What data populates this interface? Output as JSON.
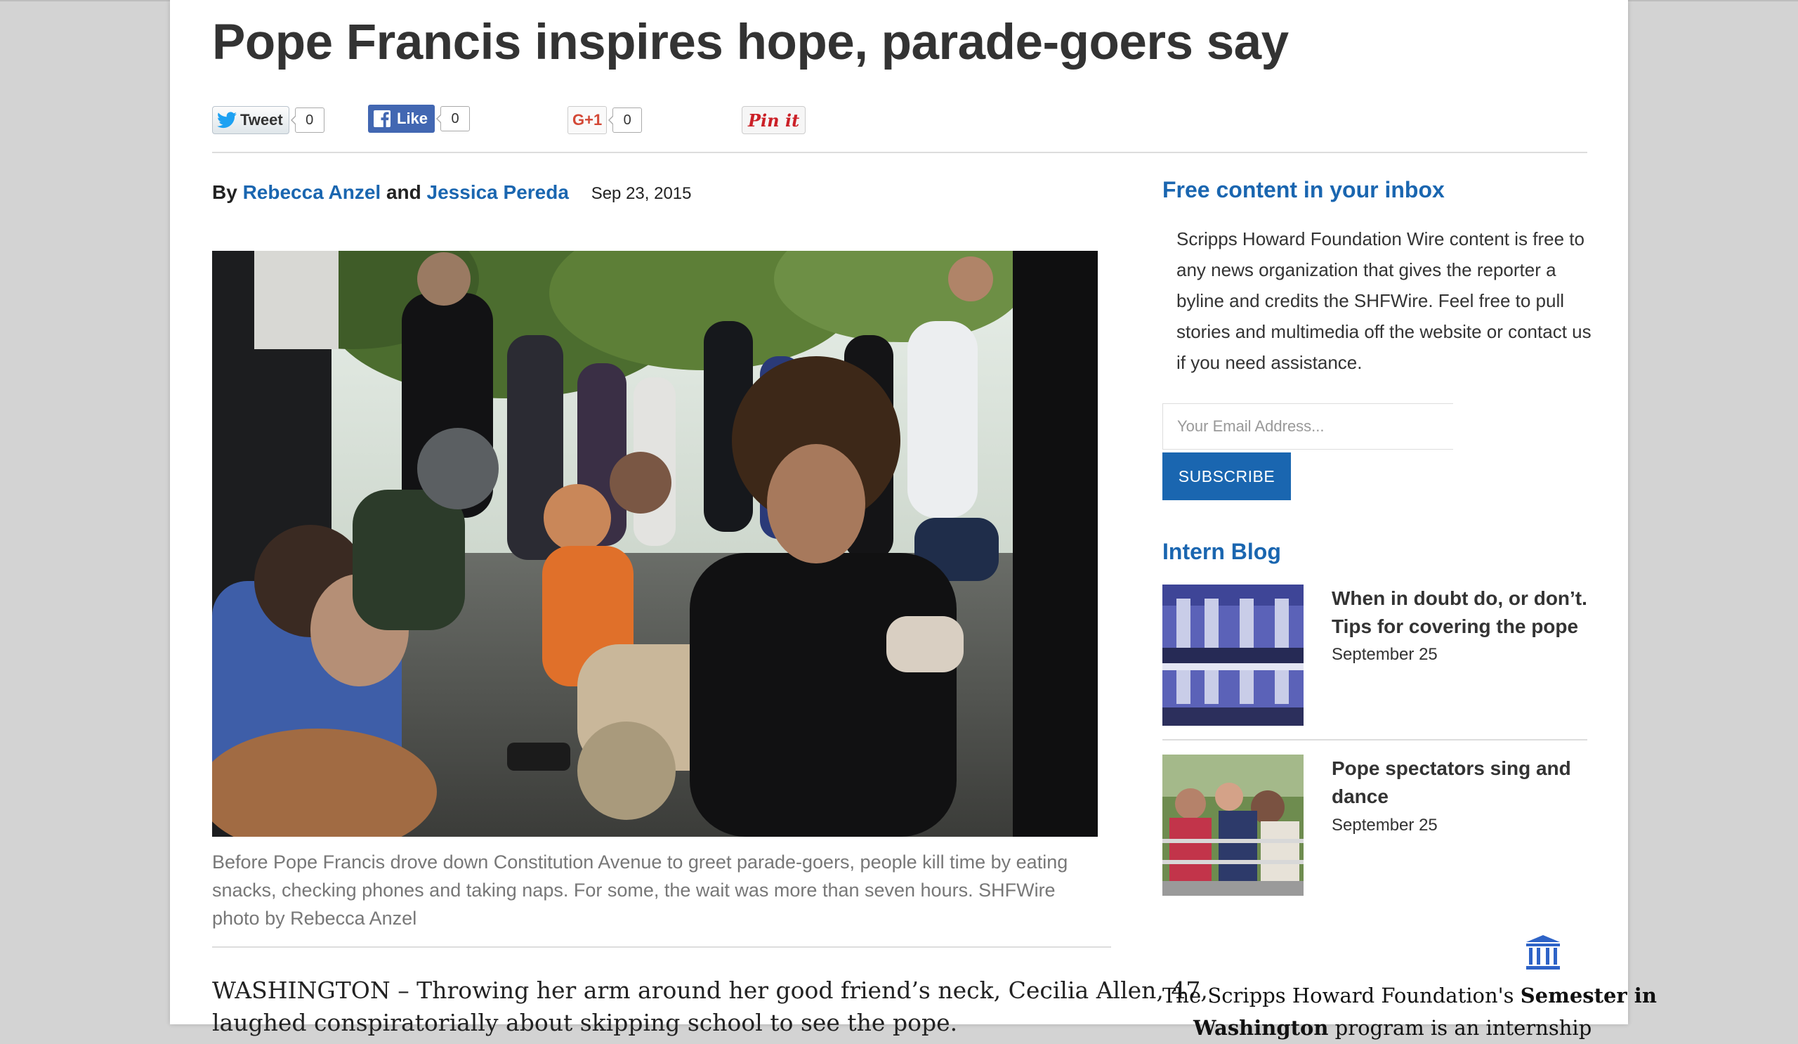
{
  "article": {
    "title": "Pope Francis inspires hope, parade-goers say",
    "byline_prefix": "By",
    "author1": "Rebecca Anzel",
    "byline_and": "and",
    "author2": "Jessica Pereda",
    "date": "Sep 23, 2015",
    "photo_caption": "Before Pope Francis drove down Constitution Avenue to greet parade-goers, people kill time by eating snacks, checking phones and taking naps. For some, the wait was more than seven hours. SHFWire photo by Rebecca Anzel",
    "body_first_line": "WASHINGTON – Throwing her arm around her good friend’s neck, Cecilia Allen, 47,",
    "body_second_line": "laughed conspiratorially about skipping school to see the pope."
  },
  "share": {
    "tweet_label": "Tweet",
    "tweet_count": "0",
    "like_label": "Like",
    "like_count": "0",
    "gplus_label": "G+1",
    "gplus_count": "0",
    "pin_label": "Pin it"
  },
  "sidebar": {
    "newsletter_heading": "Free content in your inbox",
    "newsletter_text": "Scripps Howard Foundation Wire content is free to any news organization that gives the reporter a byline and credits the SHFWire. Feel free to pull stories and multimedia off the website or contact us if you need assistance.",
    "email_placeholder": "Your Email Address...",
    "subscribe_label": "SUBSCRIBE",
    "intern_blog_heading": "Intern Blog",
    "blog_items": [
      {
        "title": "When in doubt do, or don’t. Tips for covering the pope",
        "date": "September 25"
      },
      {
        "title": "Pope spectators sing and dance",
        "date": "September 25"
      }
    ],
    "promo_prefix": "The Scripps Howard Foundation's",
    "promo_bold": "Semester in",
    "promo_line2_bold": "Washington",
    "promo_line2": "program is an internship"
  },
  "colors": {
    "accent": "#1a66b0",
    "facebook": "#4267b2",
    "pinterest": "#cb2027",
    "google_plus": "#d34836",
    "page_background": "#d3d3d3"
  }
}
